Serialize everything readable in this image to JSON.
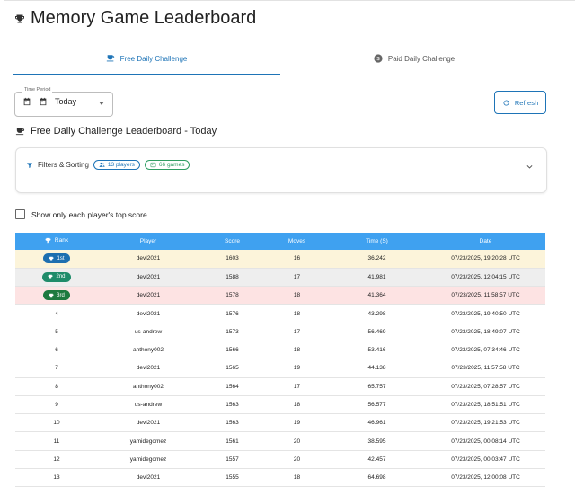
{
  "header": {
    "title": "Memory Game Leaderboard"
  },
  "tabs": [
    {
      "label": "Free Daily Challenge",
      "active": true,
      "icon": "cup-icon"
    },
    {
      "label": "Paid Daily Challenge",
      "active": false,
      "icon": "dollar-icon"
    }
  ],
  "time_period": {
    "label": "Time Period",
    "value": "Today"
  },
  "refresh_label": "Refresh",
  "section_title": "Free Daily Challenge Leaderboard - Today",
  "filters": {
    "label": "Filters & Sorting",
    "players_chip": "13 players",
    "games_chip": "66 games"
  },
  "checkbox_label": "Show only each player's top score",
  "table": {
    "headers": [
      "Rank",
      "Player",
      "Score",
      "Moves",
      "Time (S)",
      "Date"
    ],
    "rows": [
      {
        "rank": "1st",
        "player": "devl2021",
        "score": "1603",
        "moves": "16",
        "time": "36.242",
        "date": "07/23/2025, 19:20:28 UTC"
      },
      {
        "rank": "2nd",
        "player": "devl2021",
        "score": "1588",
        "moves": "17",
        "time": "41.981",
        "date": "07/23/2025, 12:04:15 UTC"
      },
      {
        "rank": "3rd",
        "player": "devl2021",
        "score": "1578",
        "moves": "18",
        "time": "41.364",
        "date": "07/23/2025, 11:58:57 UTC"
      },
      {
        "rank": "4",
        "player": "devl2021",
        "score": "1576",
        "moves": "18",
        "time": "43.298",
        "date": "07/23/2025, 19:40:50 UTC"
      },
      {
        "rank": "5",
        "player": "us-andrew",
        "score": "1573",
        "moves": "17",
        "time": "56.469",
        "date": "07/23/2025, 18:49:07 UTC"
      },
      {
        "rank": "6",
        "player": "anthony002",
        "score": "1566",
        "moves": "18",
        "time": "53.416",
        "date": "07/23/2025, 07:34:46 UTC"
      },
      {
        "rank": "7",
        "player": "devl2021",
        "score": "1565",
        "moves": "19",
        "time": "44.138",
        "date": "07/23/2025, 11:57:58 UTC"
      },
      {
        "rank": "8",
        "player": "anthony002",
        "score": "1564",
        "moves": "17",
        "time": "65.757",
        "date": "07/23/2025, 07:28:57 UTC"
      },
      {
        "rank": "9",
        "player": "us-andrew",
        "score": "1563",
        "moves": "18",
        "time": "56.577",
        "date": "07/23/2025, 18:51:51 UTC"
      },
      {
        "rank": "10",
        "player": "devl2021",
        "score": "1563",
        "moves": "19",
        "time": "46.961",
        "date": "07/23/2025, 19:21:53 UTC"
      },
      {
        "rank": "11",
        "player": "yamidegomez",
        "score": "1561",
        "moves": "20",
        "time": "38.595",
        "date": "07/23/2025, 00:08:14 UTC"
      },
      {
        "rank": "12",
        "player": "yamidegomez",
        "score": "1557",
        "moves": "20",
        "time": "42.457",
        "date": "07/23/2025, 00:03:47 UTC"
      },
      {
        "rank": "13",
        "player": "devl2021",
        "score": "1555",
        "moves": "18",
        "time": "64.698",
        "date": "07/23/2025, 12:00:08 UTC"
      }
    ]
  },
  "colors": {
    "accent": "#1e74b7",
    "table_header": "#3fa1f0",
    "gold": "#fcf4da",
    "silver": "#eeeeee",
    "bronze": "#fde3e3",
    "badge_blue": "#1d6fb0",
    "badge_green": "#1f8c6a",
    "badge_darkgreen": "#1e7a3f"
  }
}
